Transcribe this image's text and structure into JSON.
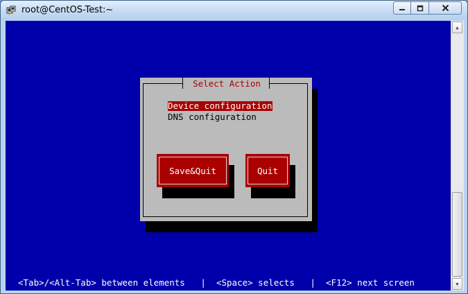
{
  "window": {
    "title": "root@CentOS-Test:~",
    "controls": {
      "minimize": "–",
      "maximize": "▢",
      "close": "✕"
    }
  },
  "dialog": {
    "title": "Select Action",
    "items": [
      {
        "label": "Device configuration",
        "selected": true
      },
      {
        "label": "DNS configuration",
        "selected": false
      }
    ],
    "buttons": {
      "save_quit": "Save&Quit",
      "quit": "Quit"
    }
  },
  "status_bar": {
    "text": "<Tab>/<Alt-Tab> between elements   |  <Space> selects   |  <F12> next screen"
  },
  "scrollbar": {
    "up_arrow": "▲",
    "down_arrow": "▼"
  },
  "colors": {
    "terminal_bg": "#0000aa",
    "dialog_bg": "#bbbbbb",
    "accent_red": "#aa0000",
    "text_white": "#ffffff"
  }
}
